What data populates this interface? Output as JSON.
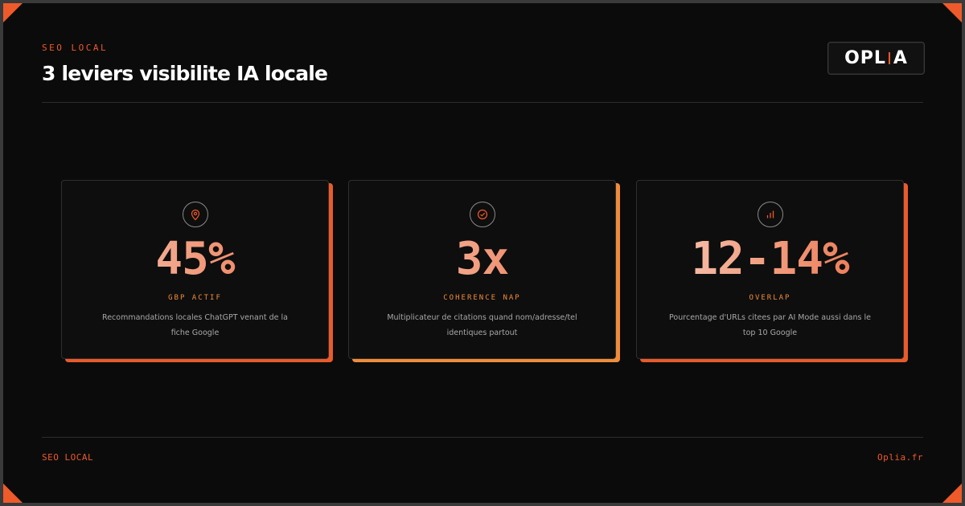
{
  "header": {
    "eyebrow": "SEO LOCAL",
    "title": "3 leviers visibilite IA locale"
  },
  "logo": {
    "part1": "OPL",
    "accent": "I",
    "part2": "A",
    "accent_icon": "signal-icon"
  },
  "cards": [
    {
      "icon": "location-pin-icon",
      "value": "45%",
      "label": "GBP ACTIF",
      "description": "Recommandations locales ChatGPT venant de la fiche Google"
    },
    {
      "icon": "check-circle-icon",
      "value": "3x",
      "label": "COHERENCE NAP",
      "description": "Multiplicateur de citations quand nom/adresse/tel identiques partout"
    },
    {
      "icon": "bar-chart-icon",
      "value": "12-14%",
      "label": "OVERLAP",
      "description": "Pourcentage d'URLs citees par AI Mode aussi dans le top 10 Google"
    }
  ],
  "footer": {
    "left": "SEO LOCAL",
    "right": "Oplia.fr"
  },
  "colors": {
    "accent": "#ee5a2a",
    "accent_light": "#f08c3a",
    "background": "#0b0b0b"
  }
}
